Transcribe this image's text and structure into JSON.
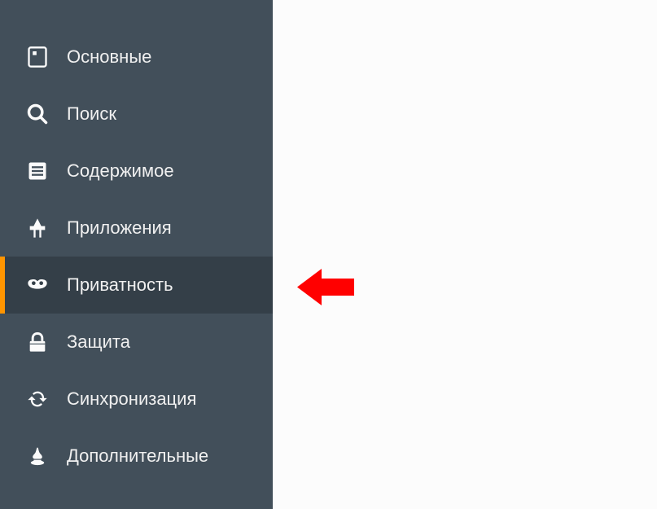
{
  "sidebar": {
    "items": [
      {
        "label": "Основные",
        "icon": "general-icon",
        "active": false
      },
      {
        "label": "Поиск",
        "icon": "search-icon",
        "active": false
      },
      {
        "label": "Содержимое",
        "icon": "content-icon",
        "active": false
      },
      {
        "label": "Приложения",
        "icon": "applications-icon",
        "active": false
      },
      {
        "label": "Приватность",
        "icon": "privacy-icon",
        "active": true
      },
      {
        "label": "Защита",
        "icon": "security-icon",
        "active": false
      },
      {
        "label": "Синхронизация",
        "icon": "sync-icon",
        "active": false
      },
      {
        "label": "Дополнительные",
        "icon": "advanced-icon",
        "active": false
      }
    ]
  },
  "annotation": {
    "arrow_color": "#FF0000",
    "points_to": "Приватность"
  }
}
